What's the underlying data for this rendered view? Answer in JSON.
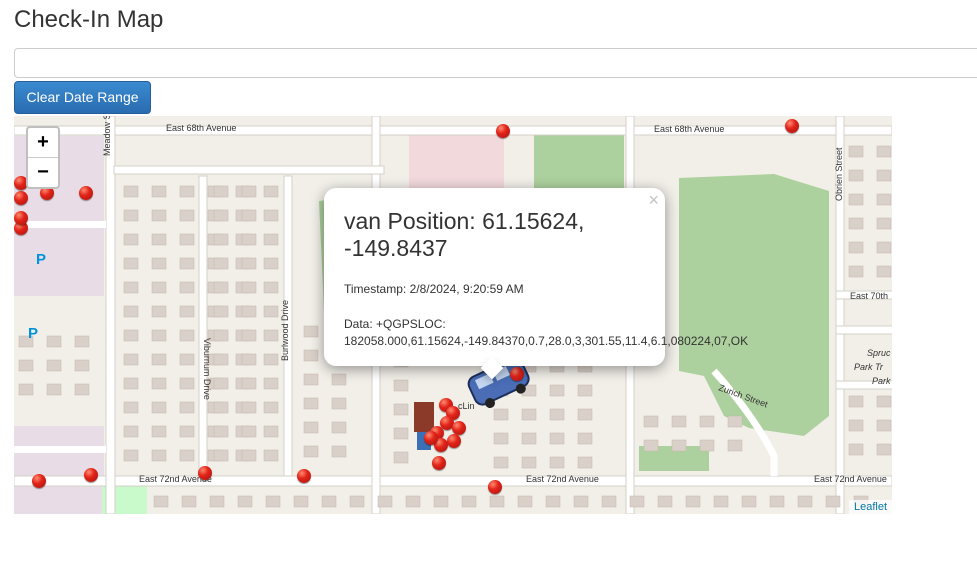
{
  "page": {
    "title": "Check-In Map"
  },
  "toolbar": {
    "clear_label": "Clear Date Range",
    "date_range_value": ""
  },
  "map": {
    "zoom_in": "+",
    "zoom_out": "−",
    "attribution": "Leaflet",
    "streets": {
      "e68_left": "East 68th Avenue",
      "e68_right": "East 68th Avenue",
      "e72_left": "East 72nd Avenue",
      "e72_mid": "East 72nd Avenue",
      "e72_right": "East 72nd Avenue",
      "e70": "East 70th",
      "viburnum": "Viburnum Drive",
      "burlwood": "Burlwood Drive",
      "obrien": "Obrien Street",
      "zurich": "Zurich Street",
      "meadow": "Meadow S",
      "mclin": "cLin",
      "spruce1": "Spruc",
      "spruce2": "Park Tr",
      "spruce3": "Park"
    },
    "parking_label": "P"
  },
  "popup": {
    "title": "van Position: 61.15624, -149.8437",
    "timestamp": "Timestamp: 2/8/2024, 9:20:59 AM",
    "data": "Data: +QGPSLOC: 182058.000,61.15624,-149.84370,0.7,28.0,3,301.55,11.4,6.1,080224,07,OK",
    "close": "×"
  },
  "colors": {
    "park": "#add19e",
    "road": "#ffffff",
    "building": "#d9d0c9",
    "pin": "#e2241a",
    "button": "#337ab7"
  }
}
